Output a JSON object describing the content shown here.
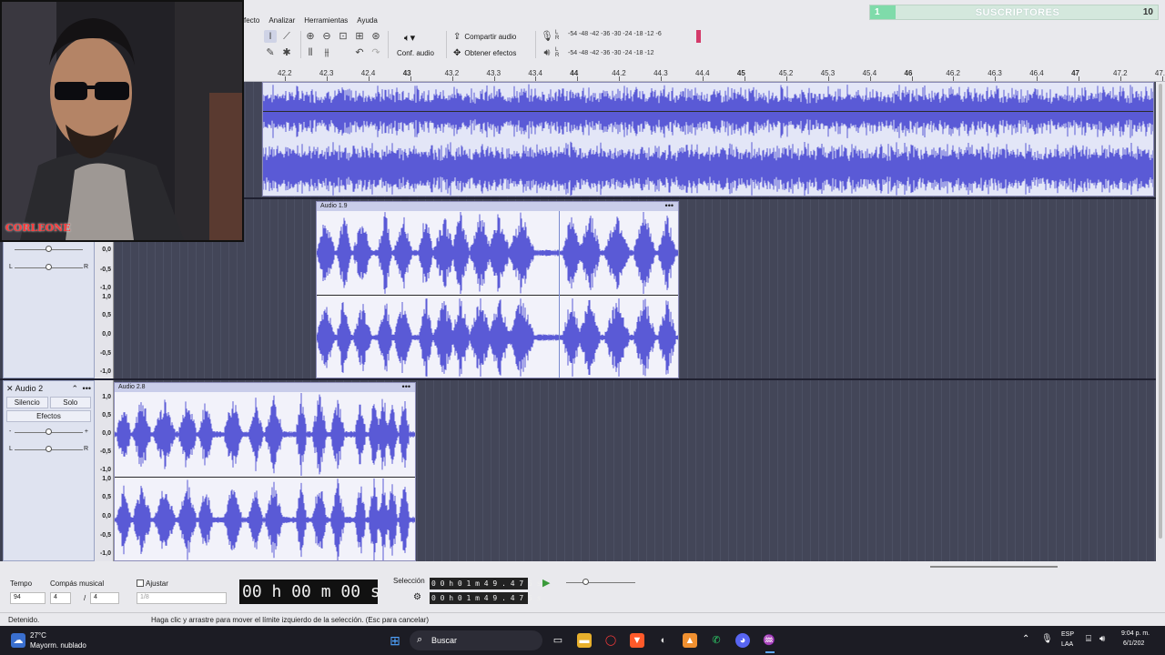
{
  "menu": {
    "items": [
      "fecto",
      "Analizar",
      "Herramientas",
      "Ayuda"
    ]
  },
  "toolbar": {
    "share_audio": "Compartir audio",
    "get_effects": "Obtener efectos",
    "audio_setup": "Conf. audio",
    "meter_top": "-54 -48 -42 -36 -30 -24 -18 -12 -6",
    "meter_bottom": "-54 -48 -42 -36 -30 -24 -18 -12",
    "lr_top": "L\nR",
    "lr_bottom": "L\nR"
  },
  "subscriber_widget": {
    "left_value": "1",
    "label": "SUSCRIPTORES",
    "count": "10"
  },
  "ruler": {
    "ticks": [
      "42.2",
      "42.3",
      "42.4",
      "43",
      "43.2",
      "43.3",
      "43.4",
      "44",
      "44.2",
      "44.3",
      "44.4",
      "45",
      "45.2",
      "45.3",
      "45.4",
      "46",
      "46.2",
      "46.3",
      "46.4",
      "47",
      "47.2",
      "47.3"
    ],
    "major": [
      "43",
      "44",
      "45",
      "46",
      "47"
    ]
  },
  "scale_labels": [
    "1,0",
    "0,5",
    "0,0",
    "-0,5",
    "-1,0"
  ],
  "tracks": [
    {
      "name": "",
      "clips": [
        {
          "label": ""
        }
      ]
    },
    {
      "name": "",
      "pan_left": "L",
      "pan_right": "R",
      "clips": [
        {
          "label": "Audio 1.9",
          "menu": "•••"
        }
      ]
    },
    {
      "name": "Audio 2",
      "mute": "Silencio",
      "solo": "Solo",
      "effects": "Efectos",
      "pan_left": "L",
      "pan_right": "R",
      "clips": [
        {
          "label": "Audio 2.8",
          "menu": "•••"
        }
      ]
    }
  ],
  "webcam": {
    "watermark": "CORLEONE"
  },
  "bottom": {
    "tempo_label": "Tempo",
    "tempo_value": "94",
    "meter_label": "Compás musical",
    "meter_num": "4",
    "meter_den": "4",
    "snap_label": "Ajustar",
    "snap_value": "1/8",
    "time_display": "00 h 00 m 00 s",
    "selection_label": "Selección",
    "sel_start": "0 0 h 0 1 m 4 9 . 4 7 5 s",
    "sel_end": "0 0 h 0 1 m 4 9 . 4 7 5 s"
  },
  "status": {
    "state": "Detenido.",
    "hint": "Haga clic y arrastre para mover el límite izquierdo de la selección. (Esc para cancelar)"
  },
  "taskbar": {
    "weather_temp": "27°C",
    "weather_desc": "Mayorm. nublado",
    "search": "Buscar",
    "lang": "ESP",
    "lang2": "LAA",
    "time": "9:04 p. m.",
    "date": "6/1/202"
  },
  "colors": {
    "waveform": "#5a5ad6",
    "track_bg": "#3e4152",
    "accent": "#7fdbaa"
  }
}
